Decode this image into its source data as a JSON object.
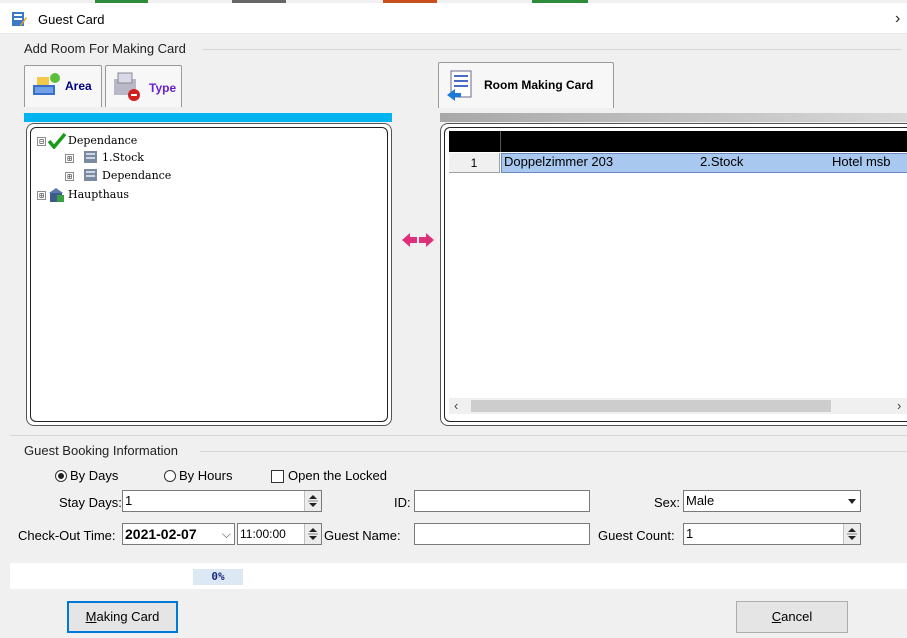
{
  "window": {
    "title": "Guest Card",
    "close_glyph": "›"
  },
  "add_room": {
    "group_title": "Add Room For Making Card",
    "tabs": [
      {
        "label": "Area",
        "icon": "area-icon"
      },
      {
        "label": "Type",
        "icon": "type-icon"
      }
    ],
    "tree": [
      {
        "label": "Dependance",
        "level": 0,
        "expander": "⊟",
        "icon": "check-icon"
      },
      {
        "label": "1.Stock",
        "level": 1,
        "expander": "⊞",
        "icon": "floor-icon"
      },
      {
        "label": "Dependance",
        "level": 1,
        "expander": "⊞",
        "icon": "floor-icon"
      },
      {
        "label": "Haupthaus",
        "level": 0,
        "expander": "⊞",
        "icon": "building-icon"
      }
    ],
    "transfer_icon": "double-arrow-icon"
  },
  "room_card": {
    "tab_label": "Room Making Card",
    "rows": [
      {
        "num": "1",
        "room": "Doppelzimmer 203",
        "floor": "2.Stock",
        "building": "Hotel msb"
      }
    ]
  },
  "booking": {
    "group_title": "Guest Booking Information",
    "by_days": "By Days",
    "by_hours": "By Hours",
    "open_locked": "Open the Locked",
    "stay_days_label": "Stay Days:",
    "stay_days_value": "1",
    "id_label": "ID:",
    "id_value": "",
    "sex_label": "Sex:",
    "sex_value": "Male",
    "checkout_label": "Check-Out Time:",
    "checkout_date": "2021-02-07",
    "checkout_time": "11:00:00",
    "guest_name_label": "Guest Name:",
    "guest_name_value": "",
    "guest_count_label": "Guest Count:",
    "guest_count_value": "1"
  },
  "progress": {
    "percent": 0,
    "text": "0%"
  },
  "buttons": {
    "making_card": "Making Card",
    "cancel": "Cancel"
  },
  "colors": {
    "accent": "#00b4f0",
    "selection": "#a8c8f0"
  }
}
